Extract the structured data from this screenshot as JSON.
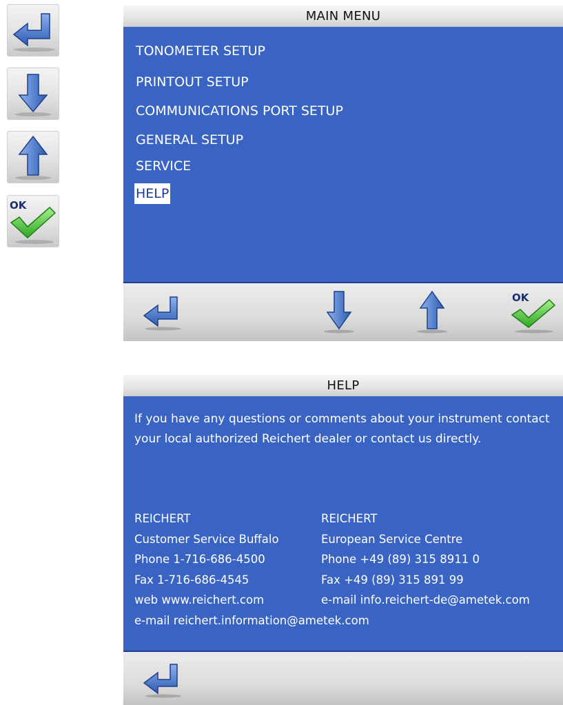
{
  "legend": {
    "items": [
      {
        "icon": "enter-back-icon"
      },
      {
        "icon": "arrow-down-icon"
      },
      {
        "icon": "arrow-up-icon"
      },
      {
        "icon": "ok-check-icon",
        "label": "OK"
      }
    ]
  },
  "main_menu": {
    "title": "MAIN  MENU",
    "items": [
      {
        "label": "TONOMETER SETUP"
      },
      {
        "label": "PRINTOUT SETUP"
      },
      {
        "label": "COMMUNICATIONS PORT SETUP"
      },
      {
        "label": "GENERAL SETUP"
      },
      {
        "label": "SERVICE"
      },
      {
        "label": "HELP",
        "selected": true
      }
    ],
    "footer": {
      "ok_label": "OK"
    }
  },
  "help": {
    "title": "HELP",
    "intro": "If you have any questions or comments about your instrument contact your local authorized Reichert dealer or contact us directly.",
    "us": {
      "company": "REICHERT",
      "dept": "Customer Service Buffalo",
      "phone": "Phone  1-716-686-4500",
      "fax": "Fax  1-716-686-4545",
      "web": "web  www.reichert.com"
    },
    "eu": {
      "company": "REICHERT",
      "dept": "European Service Centre",
      "phone": "Phone  +49 (89) 315 8911 0",
      "fax": "Fax  +49 (89) 315 891 99",
      "email": "e-mail info.reichert-de@ametek.com"
    },
    "us_email": "e-mail reichert.information@ametek.com"
  },
  "colors": {
    "screen_blue": "#3a64c4",
    "arrow_blue": "#3561b8",
    "check_green": "#4cc23a",
    "ok_text_blue": "#1a2f73"
  }
}
